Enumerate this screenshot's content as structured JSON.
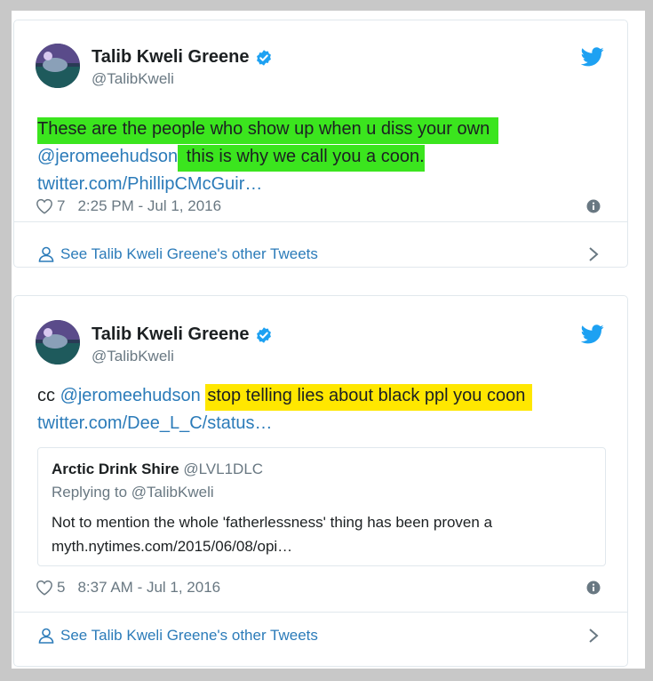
{
  "tweets": [
    {
      "name": "Talib Kweli Greene",
      "handle": "@TalibKweli",
      "text": {
        "line1_hl": "These are the people who show up when u diss your own",
        "mention": "@jeromeehudson",
        "line2_hl": "this is why we call you a coon.",
        "link": "twitter.com/PhillipCMcGuir…"
      },
      "likes": "7",
      "timestamp": "2:25 PM - Jul 1, 2016",
      "footer": "See Talib Kweli Greene's other Tweets"
    },
    {
      "name": "Talib Kweli Greene",
      "handle": "@TalibKweli",
      "text": {
        "prefix": "cc",
        "mention": "@jeromeehudson",
        "hl": "stop telling lies about black ppl you coon",
        "link": "twitter.com/Dee_L_C/status…"
      },
      "quote": {
        "name": "Arctic Drink Shire",
        "handle": "@LVL1DLC",
        "replying": "Replying to @TalibKweli",
        "line1": "Not to mention the whole 'fatherlessness' thing has been proven a",
        "line2": "myth.nytimes.com/2015/06/08/opi…"
      },
      "likes": "5",
      "timestamp": "8:37 AM - Jul 1, 2016",
      "footer": "See Talib Kweli Greene's other Tweets"
    }
  ],
  "colors": {
    "link": "#2b7bb9",
    "highlight_green": "#3be51e",
    "highlight_yellow": "#ffe700",
    "twitter_blue": "#1da1f2"
  },
  "icons": [
    "verified-badge-icon",
    "twitter-bird-icon",
    "heart-icon",
    "info-icon",
    "person-icon",
    "chevron-right-icon"
  ]
}
